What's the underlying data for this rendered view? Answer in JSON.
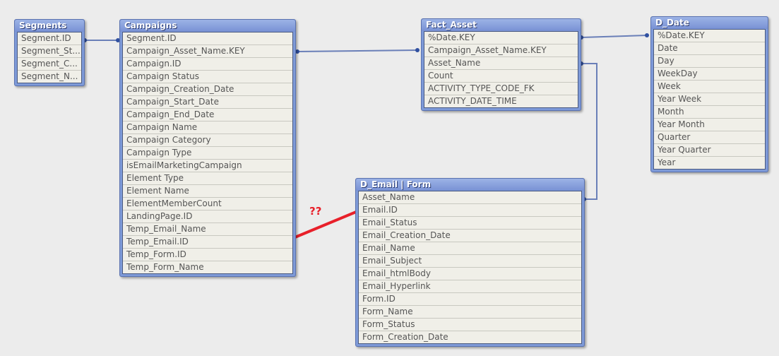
{
  "tables": {
    "segments": {
      "title": "Segments",
      "fields": [
        "Segment.ID",
        "Segment_St...",
        "Segment_C...",
        "Segment_N..."
      ]
    },
    "campaigns": {
      "title": "Campaigns",
      "fields": [
        "Segment.ID",
        "Campaign_Asset_Name.KEY",
        "Campaign.ID",
        "Campaign Status",
        "Campaign_Creation_Date",
        "Campaign_Start_Date",
        "Campaign_End_Date",
        "Campaign Name",
        "Campaign Category",
        "Campaign Type",
        "isEmailMarketingCampaign",
        "Element Type",
        "Element Name",
        "ElementMemberCount",
        "LandingPage.ID",
        "Temp_Email_Name",
        "Temp_Email.ID",
        "Temp_Form.ID",
        "Temp_Form_Name"
      ]
    },
    "fact_asset": {
      "title": "Fact_Asset",
      "fields": [
        "%Date.KEY",
        "Campaign_Asset_Name.KEY",
        "Asset_Name",
        "Count",
        "ACTIVITY_TYPE_CODE_FK",
        "ACTIVITY_DATE_TIME"
      ]
    },
    "d_date": {
      "title": "D_Date",
      "fields": [
        "%Date.KEY",
        "Date",
        "Day",
        "WeekDay",
        "Week",
        "Year Week",
        "Month",
        "Year Month",
        "Quarter",
        "Year Quarter",
        "Year"
      ]
    },
    "d_email_form": {
      "title": "D_Email | Form",
      "fields": [
        "Asset_Name",
        "Email.ID",
        "Email_Status",
        "Email_Creation_Date",
        "Email_Name",
        "Email_Subject",
        "Email_htmlBody",
        "Email_Hyperlink",
        "Form.ID",
        "Form_Name",
        "Form_Status",
        "Form_Creation_Date"
      ]
    }
  },
  "annotation": {
    "text": "??",
    "color": "#e8202a"
  },
  "colors": {
    "link": "#6a7fb8",
    "header": "#7e9ad8"
  }
}
